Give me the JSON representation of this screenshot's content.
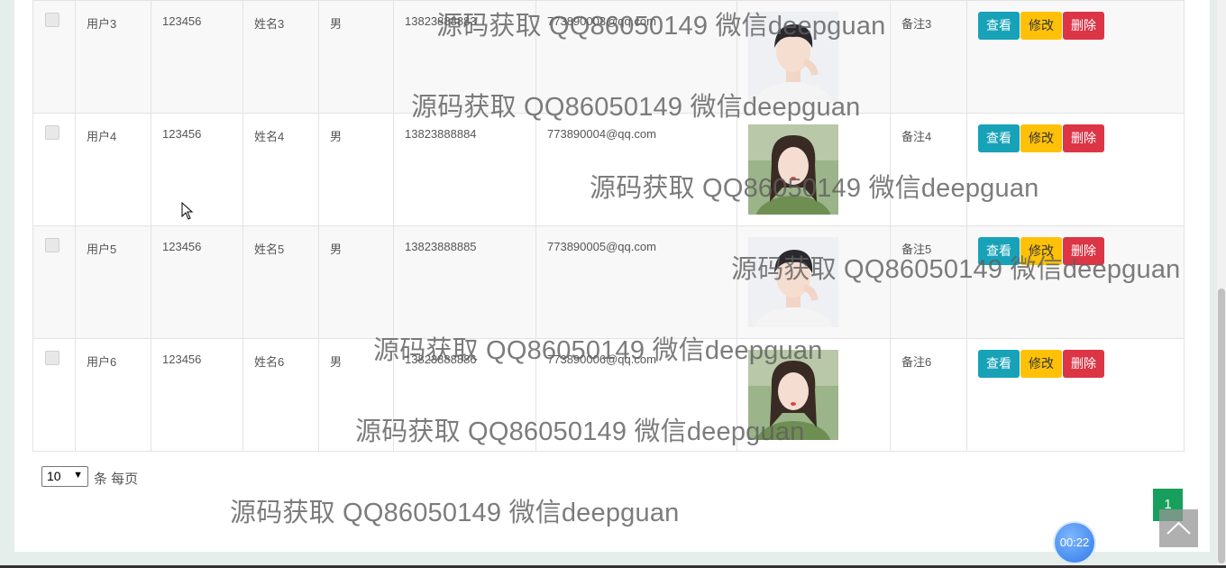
{
  "table": {
    "rows": [
      {
        "username": "用户3",
        "password": "123456",
        "name": "姓名3",
        "gender": "男",
        "phone": "13823888883",
        "email": "773890003@qq.com",
        "remark": "备注3",
        "photo": "male-avatar"
      },
      {
        "username": "用户4",
        "password": "123456",
        "name": "姓名4",
        "gender": "男",
        "phone": "13823888884",
        "email": "773890004@qq.com",
        "remark": "备注4",
        "photo": "female-avatar"
      },
      {
        "username": "用户5",
        "password": "123456",
        "name": "姓名5",
        "gender": "男",
        "phone": "13823888885",
        "email": "773890005@qq.com",
        "remark": "备注5",
        "photo": "male-avatar"
      },
      {
        "username": "用户6",
        "password": "123456",
        "name": "姓名6",
        "gender": "男",
        "phone": "13823888886",
        "email": "773890006@qq.com",
        "remark": "备注6",
        "photo": "female-avatar"
      }
    ],
    "actions": {
      "view": "查看",
      "edit": "修改",
      "delete": "删除"
    }
  },
  "pager": {
    "page_size": "10",
    "per_page_text": "条 每页",
    "current_page": "1"
  },
  "timer": "00:22",
  "watermark": "源码获取 QQ86050149 微信deepguan",
  "colors": {
    "view": "#17a2b8",
    "edit": "#ffc107",
    "delete": "#dc3545",
    "page": "#17a05d"
  }
}
